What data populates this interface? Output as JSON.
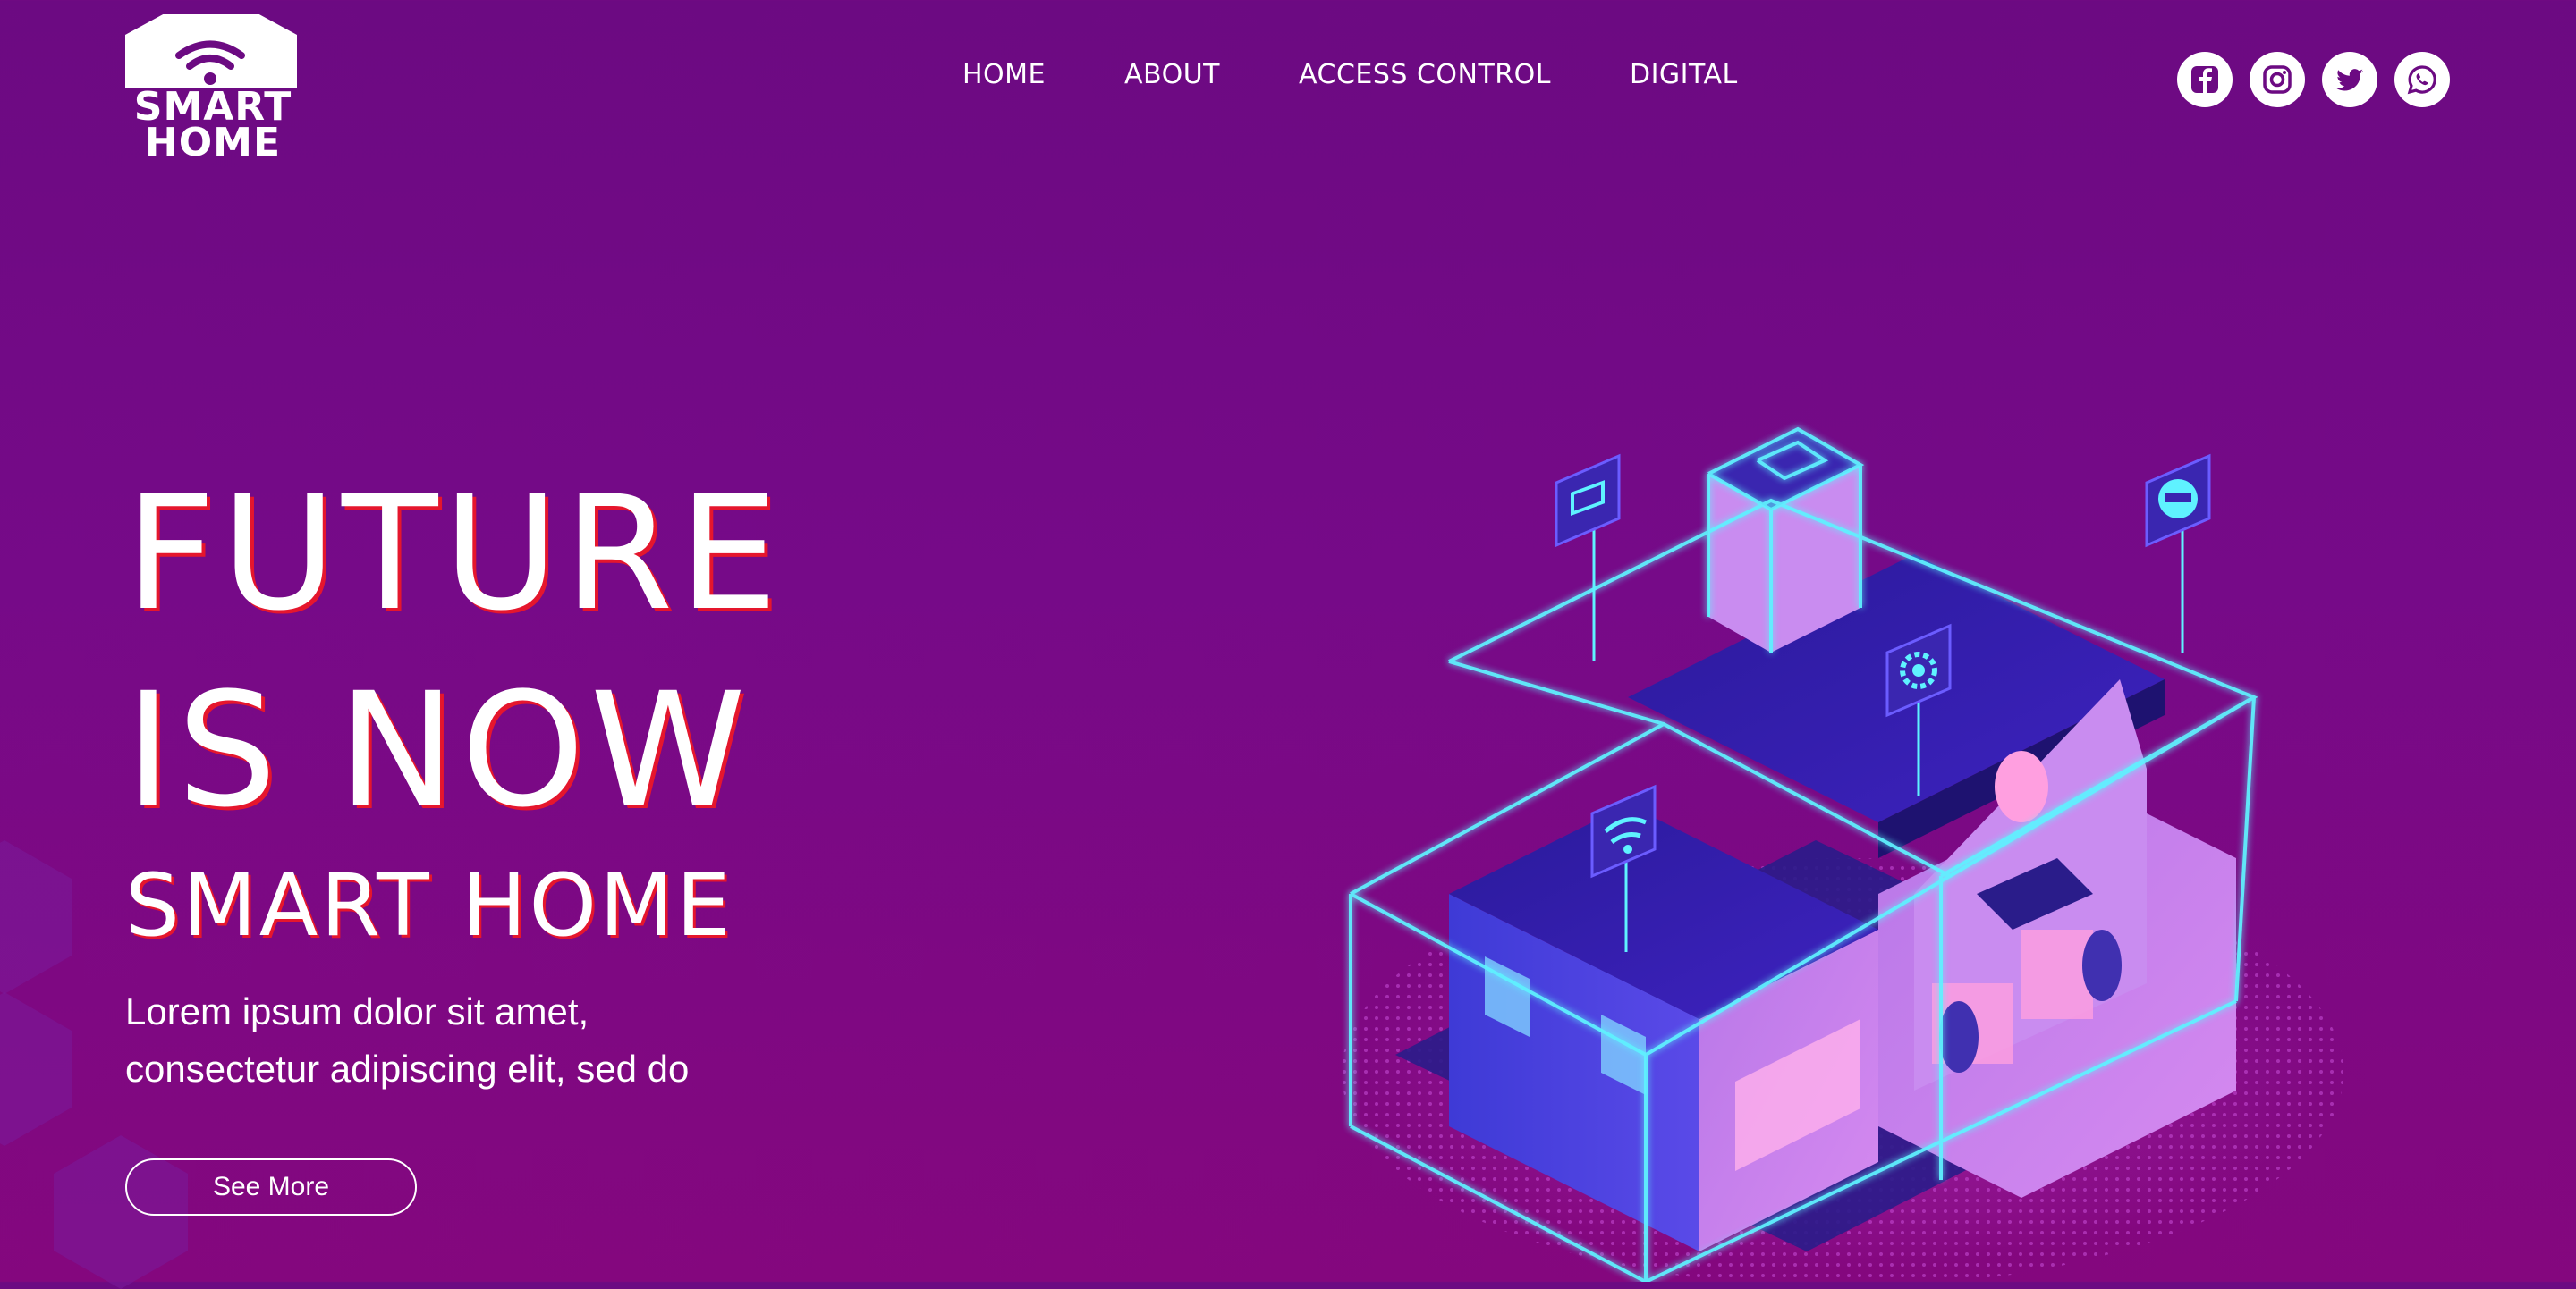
{
  "brand": {
    "line1": "SMART",
    "line2": "HOME"
  },
  "nav": {
    "items": [
      "HOME",
      "ABOUT",
      "ACCESS CONTROL",
      "DIGITAL"
    ]
  },
  "social": {
    "icons": [
      "facebook-icon",
      "instagram-icon",
      "twitter-icon",
      "whatsapp-icon"
    ]
  },
  "hero": {
    "title_line1": "FUTURE",
    "title_line2": "IS NOW",
    "subtitle": "SMART HOME",
    "desc_line1": "Lorem ipsum dolor sit amet,",
    "desc_line2": "consectetur adipiscing elit, sed do",
    "cta": "See More"
  },
  "colors": {
    "background": "#760a88",
    "text_shadow": "#e5162d",
    "neon": "#5ff2ff"
  }
}
